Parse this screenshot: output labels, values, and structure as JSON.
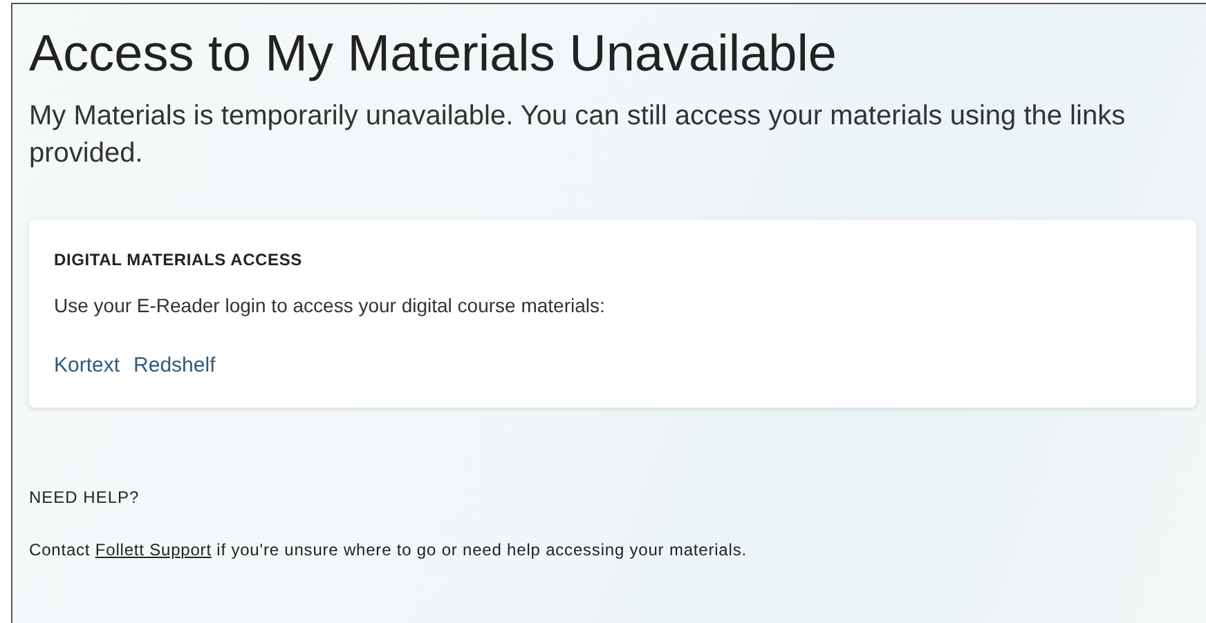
{
  "title": "Access to My Materials Unavailable",
  "subtitle": "My Materials is temporarily unavailable. You can still access your materials using the links provided.",
  "card": {
    "heading": "DIGITAL MATERIALS ACCESS",
    "text": "Use your E-Reader login to access your digital course materials:",
    "links": [
      "Kortext",
      "Redshelf"
    ]
  },
  "help": {
    "heading": "NEED HELP?",
    "before": "Contact ",
    "link": "Follett Support",
    "after": " if you're unsure where to go or need help accessing your materials."
  }
}
